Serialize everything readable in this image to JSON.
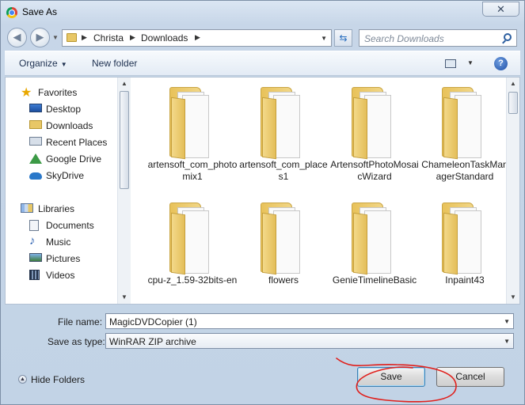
{
  "window": {
    "title": "Save As",
    "close_glyph": "✕"
  },
  "navigation": {
    "back_glyph": "◀",
    "forward_glyph": "▶",
    "breadcrumb": [
      "Christa",
      "Downloads"
    ],
    "search_placeholder": "Search Downloads"
  },
  "toolbar": {
    "organize_label": "Organize",
    "new_folder_label": "New folder",
    "help_glyph": "?"
  },
  "sidebar": {
    "favorites": {
      "label": "Favorites",
      "items": [
        "Desktop",
        "Downloads",
        "Recent Places",
        "Google Drive",
        "SkyDrive"
      ]
    },
    "libraries": {
      "label": "Libraries",
      "items": [
        "Documents",
        "Music",
        "Pictures",
        "Videos"
      ]
    }
  },
  "files": [
    "artensoft_com_photomix1",
    "artensoft_com_places1",
    "ArtensoftPhotoMosaicWizard",
    "ChameleonTaskManagerStandard",
    "cpu-z_1.59-32bits-en",
    "flowers",
    "GenieTimelineBasic",
    "Inpaint43"
  ],
  "form": {
    "file_name_label": "File name:",
    "file_name_value": "MagicDVDCopier (1)",
    "save_type_label": "Save as type:",
    "save_type_value": "WinRAR ZIP archive"
  },
  "footer": {
    "hide_folders_label": "Hide Folders",
    "save_label": "Save",
    "cancel_label": "Cancel"
  },
  "colors": {
    "annotation": "#e0201c",
    "accent": "#3c7fb1"
  }
}
